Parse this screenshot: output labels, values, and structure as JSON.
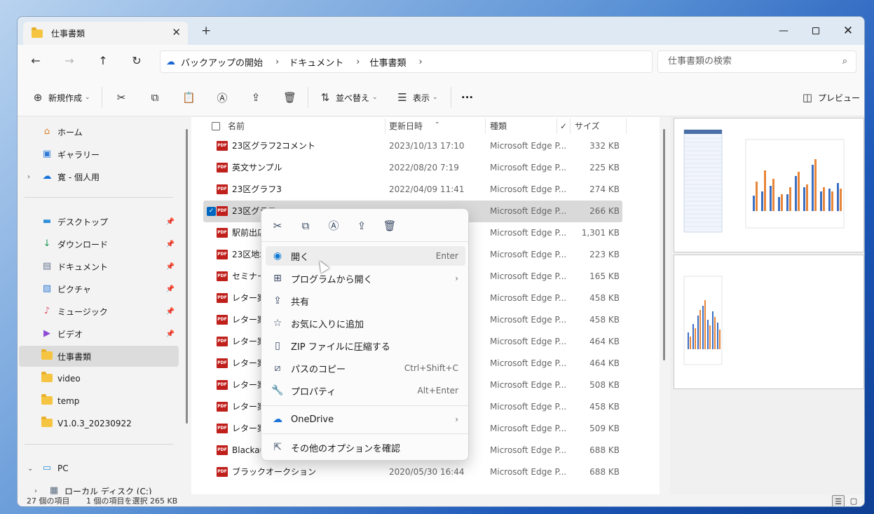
{
  "window": {
    "tab_title": "仕事書類",
    "close_glyph": "✕",
    "add_tab_glyph": "+"
  },
  "address": {
    "crumbs": [
      "バックアップの開始",
      "ドキュメント",
      "仕事書類"
    ],
    "search_placeholder": "仕事書類の検索"
  },
  "toolbar": {
    "new_label": "新規作成",
    "sort_label": "並べ替え",
    "view_label": "表示",
    "more_glyph": "···",
    "preview_label": "プレビュー"
  },
  "sidebar": {
    "items": [
      {
        "label": "ホーム",
        "icon": "home-icon"
      },
      {
        "label": "ギャラリー",
        "icon": "gallery-icon"
      },
      {
        "label": "寛 - 個人用",
        "icon": "onedrive-icon"
      },
      {
        "label": "デスクトップ",
        "icon": "desktop-icon"
      },
      {
        "label": "ダウンロード",
        "icon": "download-icon"
      },
      {
        "label": "ドキュメント",
        "icon": "document-icon"
      },
      {
        "label": "ピクチャ",
        "icon": "pictures-icon"
      },
      {
        "label": "ミュージック",
        "icon": "music-icon"
      },
      {
        "label": "ビデオ",
        "icon": "video-icon"
      },
      {
        "label": "仕事書類",
        "icon": "folder-icon"
      },
      {
        "label": "video",
        "icon": "folder-icon"
      },
      {
        "label": "temp",
        "icon": "folder-icon"
      },
      {
        "label": "V1.0.3_20230922",
        "icon": "folder-icon"
      },
      {
        "label": "PC",
        "icon": "pc-icon"
      },
      {
        "label": "ローカル ディスク (C:)",
        "icon": "drive-icon"
      }
    ]
  },
  "filelist": {
    "columns": {
      "name": "名前",
      "date": "更新日時",
      "type": "種類",
      "size": "サイズ"
    },
    "rows": [
      {
        "name": "23区グラフ2コメント",
        "date": "2023/10/13 17:10",
        "type": "Microsoft Edge P...",
        "size": "332 KB"
      },
      {
        "name": "英文サンプル",
        "date": "2022/08/20 7:19",
        "type": "Microsoft Edge P...",
        "size": "225 KB"
      },
      {
        "name": "23区グラフ3",
        "date": "2022/04/09 11:41",
        "type": "Microsoft Edge P...",
        "size": "274 KB"
      },
      {
        "name": "23区グラフ",
        "date": "",
        "type": "Microsoft Edge P...",
        "size": "266 KB"
      },
      {
        "name": "駅前出店",
        "date": "",
        "type": "Microsoft Edge P...",
        "size": "1,301 KB"
      },
      {
        "name": "23区地域",
        "date": "",
        "type": "Microsoft Edge P...",
        "size": "223 KB"
      },
      {
        "name": "セミナー",
        "date": "",
        "type": "Microsoft Edge P...",
        "size": "165 KB"
      },
      {
        "name": "レター案内",
        "date": "",
        "type": "Microsoft Edge P...",
        "size": "458 KB"
      },
      {
        "name": "レター案内",
        "date": "",
        "type": "Microsoft Edge P...",
        "size": "458 KB"
      },
      {
        "name": "レター案内",
        "date": "",
        "type": "Microsoft Edge P...",
        "size": "464 KB"
      },
      {
        "name": "レター案内",
        "date": "",
        "type": "Microsoft Edge P...",
        "size": "464 KB"
      },
      {
        "name": "レター案内",
        "date": "",
        "type": "Microsoft Edge P...",
        "size": "508 KB"
      },
      {
        "name": "レター案内",
        "date": "",
        "type": "Microsoft Edge P...",
        "size": "458 KB"
      },
      {
        "name": "レター案内",
        "date": "",
        "type": "Microsoft Edge P...",
        "size": "509 KB"
      },
      {
        "name": "Blackauc",
        "date": "",
        "type": "Microsoft Edge P...",
        "size": "688 KB"
      },
      {
        "name": "ブラックオークション",
        "date": "2020/05/30 16:44",
        "type": "Microsoft Edge P...",
        "size": "688 KB"
      }
    ]
  },
  "context_menu": {
    "open": {
      "label": "開く",
      "shortcut": "Enter"
    },
    "open_with": {
      "label": "プログラムから開く"
    },
    "share": {
      "label": "共有"
    },
    "favorite": {
      "label": "お気に入りに追加"
    },
    "zip": {
      "label": "ZIP ファイルに圧縮する"
    },
    "copy_path": {
      "label": "パスのコピー",
      "shortcut": "Ctrl+Shift+C"
    },
    "properties": {
      "label": "プロパティ",
      "shortcut": "Alt+Enter"
    },
    "onedrive": {
      "label": "OneDrive"
    },
    "more_options": {
      "label": "その他のオプションを確認"
    }
  },
  "status": {
    "count": "27 個の項目",
    "selection": "1 個の項目を選択  265 KB"
  },
  "colors": {
    "accent": "#0067c0",
    "pdf_red": "#c0201c",
    "folder_yellow": "#f5c542"
  }
}
